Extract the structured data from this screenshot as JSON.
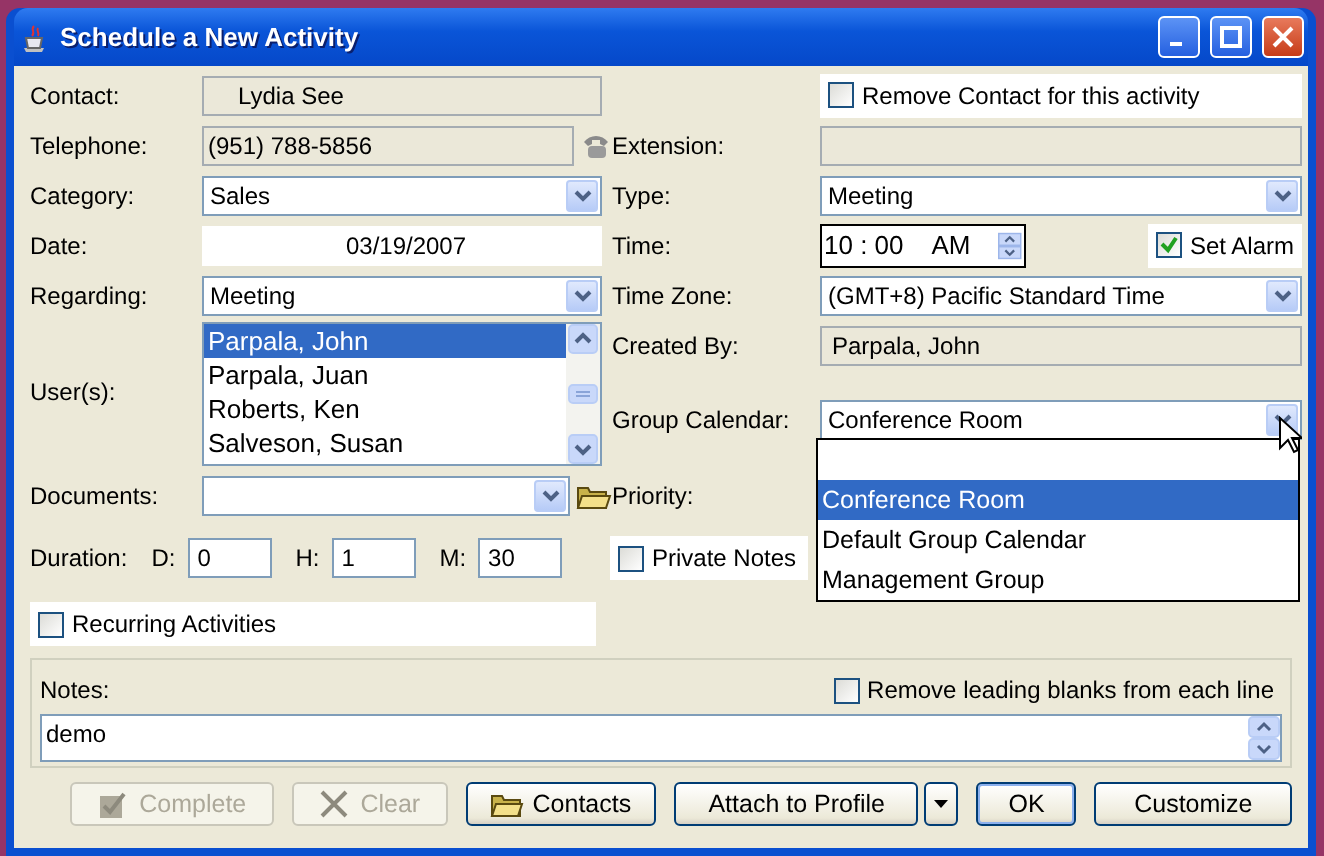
{
  "window": {
    "title": "Schedule a New Activity"
  },
  "contact": {
    "label": "Contact:",
    "value": "Lydia See"
  },
  "remove_contact": {
    "label": "Remove Contact for this activity",
    "checked": false
  },
  "telephone": {
    "label": "Telephone:",
    "value": "(951) 788-5856"
  },
  "extension": {
    "label": "Extension:"
  },
  "category": {
    "label": "Category:",
    "value": "Sales"
  },
  "type": {
    "label": "Type:",
    "value": "Meeting"
  },
  "date": {
    "label": "Date:",
    "value": "03/19/2007"
  },
  "time": {
    "label": "Time:",
    "value": "10 : 00",
    "ampm": "AM"
  },
  "set_alarm": {
    "label": "Set Alarm",
    "checked": true
  },
  "regarding": {
    "label": "Regarding:",
    "value": "Meeting"
  },
  "time_zone": {
    "label": "Time Zone:",
    "value": "(GMT+8) Pacific Standard Time"
  },
  "users": {
    "label": "User(s):",
    "items": [
      {
        "name": "Parpala, John",
        "selected": true
      },
      {
        "name": "Parpala, Juan",
        "selected": false
      },
      {
        "name": "Roberts, Ken",
        "selected": false
      },
      {
        "name": "Salveson, Susan",
        "selected": false
      }
    ]
  },
  "created_by": {
    "label": "Created By:",
    "value": "Parpala, John"
  },
  "group_calendar": {
    "label": "Group Calendar:",
    "value": "Conference Room",
    "expanded": true,
    "options": [
      {
        "label": "Conference Room",
        "selected": true
      },
      {
        "label": "Default Group Calendar",
        "selected": false
      },
      {
        "label": "Management Group",
        "selected": false
      }
    ]
  },
  "documents": {
    "label": "Documents:"
  },
  "priority": {
    "label": "Priority:"
  },
  "duration": {
    "label": "Duration:",
    "fields": [
      {
        "label": "D:",
        "value": "0"
      },
      {
        "label": "H:",
        "value": "1"
      },
      {
        "label": "M:",
        "value": "30"
      }
    ]
  },
  "private_notes": {
    "label": "Private Notes",
    "checked": false
  },
  "recurring": {
    "label": "Recurring Activities",
    "checked": false
  },
  "notes": {
    "label": "Notes:",
    "value": "demo"
  },
  "remove_blanks": {
    "label": "Remove leading blanks from each line",
    "checked": false
  },
  "buttons": [
    {
      "label": "Complete",
      "disabled": true
    },
    {
      "label": "Clear",
      "disabled": true
    },
    {
      "label": "Contacts",
      "disabled": false
    },
    {
      "label": "Attach to Profile",
      "disabled": false,
      "kind": "split"
    },
    {
      "label": "OK",
      "disabled": false,
      "kind": "default"
    },
    {
      "label": "Customize",
      "disabled": false
    }
  ]
}
